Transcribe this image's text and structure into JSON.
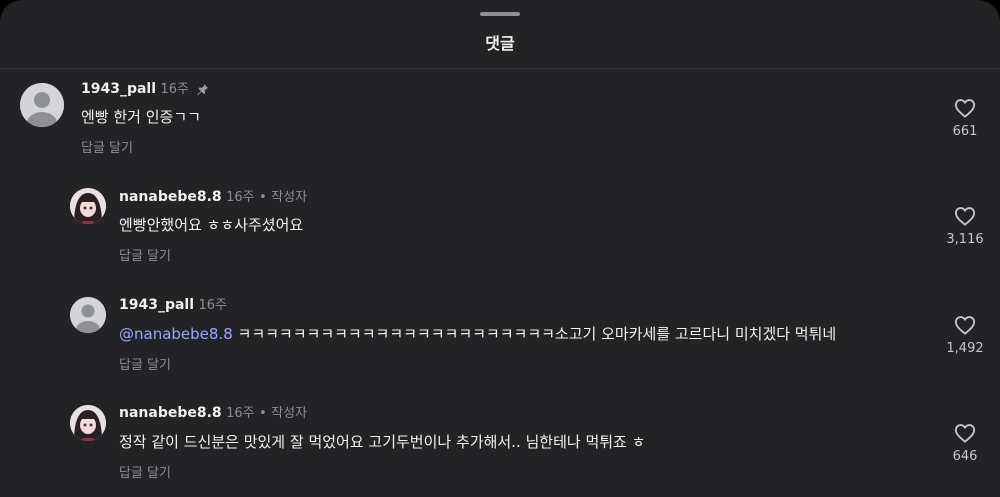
{
  "sheet": {
    "title": "댓글"
  },
  "comments": [
    {
      "user": "1943_pall",
      "time": "16주",
      "author": "",
      "mention": "",
      "text": "엔빵 한거 인증ㄱㄱ",
      "reply": "답글 달기",
      "likes": "661",
      "avatar": "default-avatar",
      "pinned": true
    },
    {
      "user": "nanabebe8.8",
      "time": "16주",
      "dot": "•",
      "author": "작성자",
      "mention": "",
      "text": "엔빵안했어요 ㅎㅎ사주셨어요",
      "reply": "답글 달기",
      "likes": "3,116",
      "avatar": "anime-avatar"
    },
    {
      "user": "1943_pall",
      "time": "16주",
      "author": "",
      "mention": "@nanabebe8.8",
      "text": " ㅋㅋㅋㅋㅋㅋㅋㅋㅋㅋㅋㅋㅋㅋㅋㅋㅋㅋㅋㅋㅋㅋㅋ소고기 오마카세를 고르다니 미치겠다 먹튀네",
      "reply": "답글 달기",
      "likes": "1,492",
      "avatar": "default-avatar"
    },
    {
      "user": "nanabebe8.8",
      "time": "16주",
      "dot": "•",
      "author": "작성자",
      "mention": "",
      "text": "정작 같이 드신분은 맛있게 잘 먹었어요 고기두번이나 추가해서.. 님한테나 먹튀죠 ㅎ",
      "reply": "답글 달기",
      "likes": "646",
      "avatar": "anime-avatar"
    }
  ]
}
